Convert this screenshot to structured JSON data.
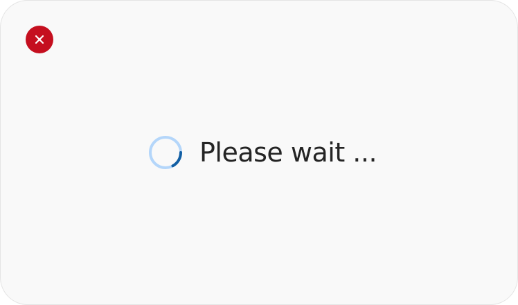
{
  "dialog": {
    "status_text": "Please wait ...",
    "close_icon": "close-x-icon",
    "spinner_icon": "loading-spinner-icon"
  },
  "colors": {
    "close_button_bg": "#c50f1f",
    "spinner_track": "#b4d6fa",
    "spinner_arc": "#115ea3",
    "text": "#242424",
    "dialog_bg": "#f9f9f9"
  }
}
